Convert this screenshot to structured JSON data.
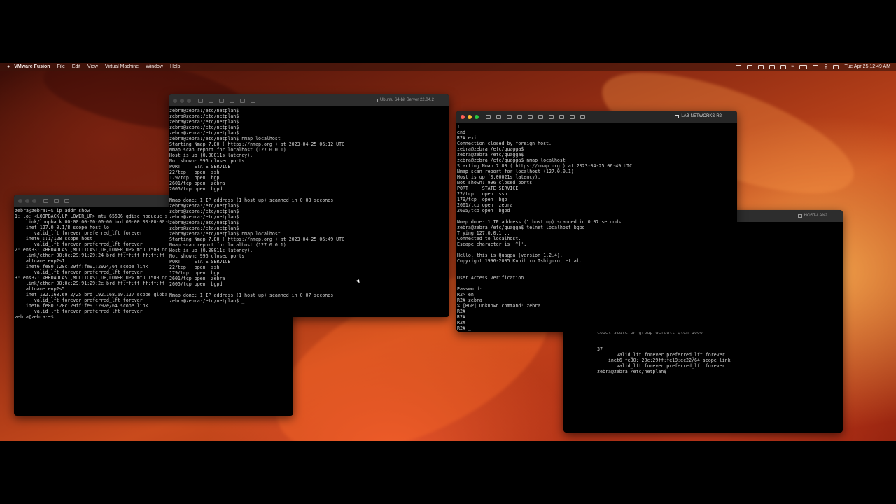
{
  "menubar": {
    "app": "VMware Fusion",
    "items": [
      "File",
      "Edit",
      "View",
      "Virtual Machine",
      "Window",
      "Help"
    ],
    "clock": "Tue Apr 25  12:49 AM"
  },
  "windows": {
    "w1": {
      "title": "",
      "lines": [
        "zebra@zebra:~$ ip addr show",
        "1: lo: <LOOPBACK,UP,LOWER_UP> mtu 65536 qdisc noqueue s",
        "    link/loopback 00:00:00:00:00:00 brd 00:00:00:00:00:0",
        "    inet 127.0.0.1/8 scope host lo",
        "       valid_lft forever preferred_lft forever",
        "    inet6 ::1/128 scope host",
        "       valid_lft forever preferred_lft forever",
        "2: ens33: <BROADCAST,MULTICAST,UP,LOWER_UP> mtu 1500 qd",
        "    link/ether 00:0c:29:91:29:24 brd ff:ff:ff:ff:ff:ff",
        "    altname enp2s1",
        "    inet6 fe80::20c:29ff:fe91:2924/64 scope link",
        "       valid_lft forever preferred_lft forever",
        "3: ens37: <BROADCAST,MULTICAST,UP,LOWER_UP> mtu 1500 qd",
        "    link/ether 00:0c:29:91:29:2e brd ff:ff:ff:ff:ff:ff",
        "    altname enp2s5",
        "    inet 192.168.69.2/25 brd 192.168.69.127 scope globa",
        "       valid_lft forever preferred_lft forever",
        "    inet6 fe80::20c:29ff:fe91:292e/64 scope link",
        "       valid_lft forever preferred_lft forever",
        "zebra@zebra:~$"
      ]
    },
    "w2": {
      "title": "Ubuntu 64-bit Server 22.04.2",
      "lines": [
        "zebra@zebra:/etc/netplan$",
        "zebra@zebra:/etc/netplan$",
        "zebra@zebra:/etc/netplan$",
        "zebra@zebra:/etc/netplan$",
        "zebra@zebra:/etc/netplan$",
        "zebra@zebra:/etc/netplan$ nmap localhost",
        "Starting Nmap 7.80 ( https://nmap.org ) at 2023-04-25 06:12 UTC",
        "Nmap scan report for localhost (127.0.0.1)",
        "Host is up (0.00011s latency).",
        "Not shown: 996 closed ports",
        "PORT     STATE SERVICE",
        "22/tcp   open  ssh",
        "179/tcp  open  bgp",
        "2601/tcp open  zebra",
        "2605/tcp open  bgpd",
        "",
        "Nmap done: 1 IP address (1 host up) scanned in 0.08 seconds",
        "zebra@zebra:/etc/netplan$",
        "zebra@zebra:/etc/netplan$",
        "zebra@zebra:/etc/netplan$",
        "zebra@zebra:/etc/netplan$",
        "zebra@zebra:/etc/netplan$",
        "zebra@zebra:/etc/netplan$ nmap localhost",
        "Starting Nmap 7.80 ( https://nmap.org ) at 2023-04-25 06:49 UTC",
        "Nmap scan report for localhost (127.0.0.1)",
        "Host is up (0.00011s latency).",
        "Not shown: 996 closed ports",
        "PORT     STATE SERVICE",
        "22/tcp   open  ssh",
        "179/tcp  open  bgp",
        "2601/tcp open  zebra",
        "2605/tcp open  bgpd",
        "",
        "Nmap done: 1 IP address (1 host up) scanned in 0.07 seconds",
        "zebra@zebra:/etc/netplan$ _"
      ]
    },
    "w3": {
      "title": "LAB-NETWORKS-R2",
      "lines": [
        "!",
        "end",
        "R2# exi",
        "Connection closed by foreign host.",
        "zebra@zebra:/etc/quagga$",
        "zebra@zebra:/etc/quagga$",
        "zebra@zebra:/etc/quagga$ nmap localhost",
        "Starting Nmap 7.80 ( https://nmap.org ) at 2023-04-25 06:49 UTC",
        "Nmap scan report for localhost (127.0.0.1)",
        "Host is up (0.00021s latency).",
        "Not shown: 996 closed ports",
        "PORT     STATE SERVICE",
        "22/tcp   open  ssh",
        "179/tcp  open  bgp",
        "2601/tcp open  zebra",
        "2605/tcp open  bgpd",
        "",
        "Nmap done: 1 IP address (1 host up) scanned in 0.07 seconds",
        "zebra@zebra:/etc/quagga$ telnet localhost bgpd",
        "Trying 127.0.0.1...",
        "Connected to localhost.",
        "Escape character is '^]'.",
        "",
        "Hello, this is Quagga (version 1.2.4).",
        "Copyright 1996-2005 Kunihiro Ishiguro, et al.",
        "",
        "",
        "User Access Verification",
        "",
        "Password:",
        "R2> en",
        "R2# zebra",
        "% [BGP] Unknown command: zebra",
        "R2#",
        "R2#",
        "R2#",
        "R2# _"
      ]
    },
    "w4": {
      "title": "HOST-LAN2",
      "lines": [
        "",
        "",
        "",
        "NKNOWN group default qlen 1000",
        "",
        "",
        "",
        "",
        "",
        "",
        "codel state UP group default qlen 1000",
        "",
        "",
        "",
        "global dynamic ens33",
        "",
        "",
        "",
        "",
        "codel state UP group default qlen 1000",
        "",
        "",
        "37",
        "       valid_lft forever preferred_lft forever",
        "    inet6 fe80::20c:29ff:fe19:ec22/64 scope link",
        "       valid_lft forever preferred_lft forever",
        "zebra@zebra:/etc/netplan$ _"
      ]
    }
  }
}
